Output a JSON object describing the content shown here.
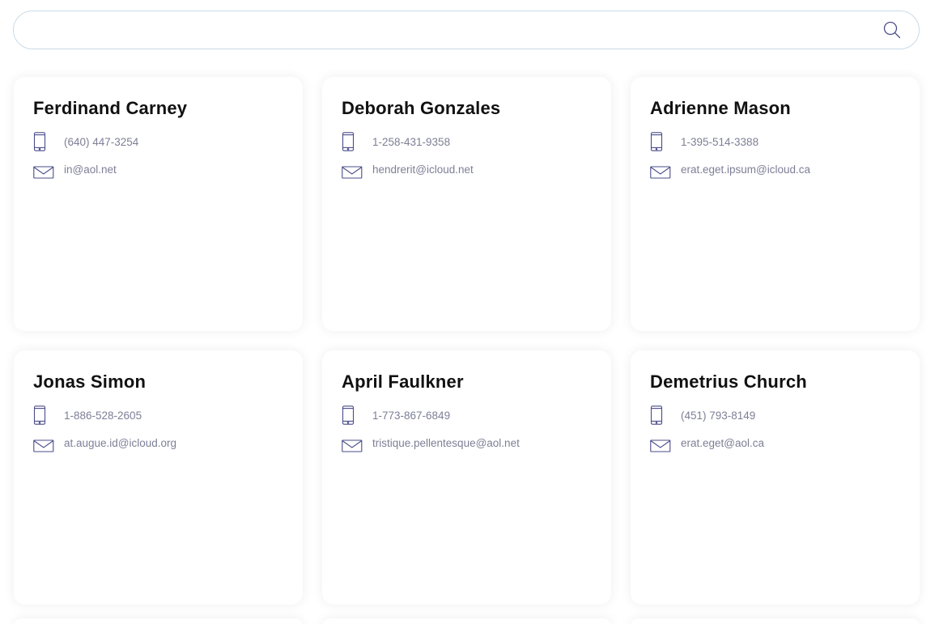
{
  "search": {
    "placeholder": "",
    "value": "",
    "icon": "search-icon"
  },
  "contacts": [
    {
      "name": "Ferdinand Carney",
      "phone": "(640) 447-3254",
      "email": "in@aol.net"
    },
    {
      "name": "Deborah Gonzales",
      "phone": "1-258-431-9358",
      "email": "hendrerit@icloud.net"
    },
    {
      "name": "Adrienne Mason",
      "phone": "1-395-514-3388",
      "email": "erat.eget.ipsum@icloud.ca"
    },
    {
      "name": "Jonas Simon",
      "phone": "1-886-528-2605",
      "email": "at.augue.id@icloud.org"
    },
    {
      "name": "April Faulkner",
      "phone": "1-773-867-6849",
      "email": "tristique.pellentesque@aol.net"
    },
    {
      "name": "Demetrius Church",
      "phone": "(451) 793-8149",
      "email": "erat.eget@aol.ca"
    }
  ],
  "icons": {
    "phone": "phone-icon",
    "email": "envelope-icon"
  },
  "colors": {
    "icon": "#4a4c8a",
    "secondary_text": "#7d7f96",
    "search_border": "#c9dbe8"
  }
}
